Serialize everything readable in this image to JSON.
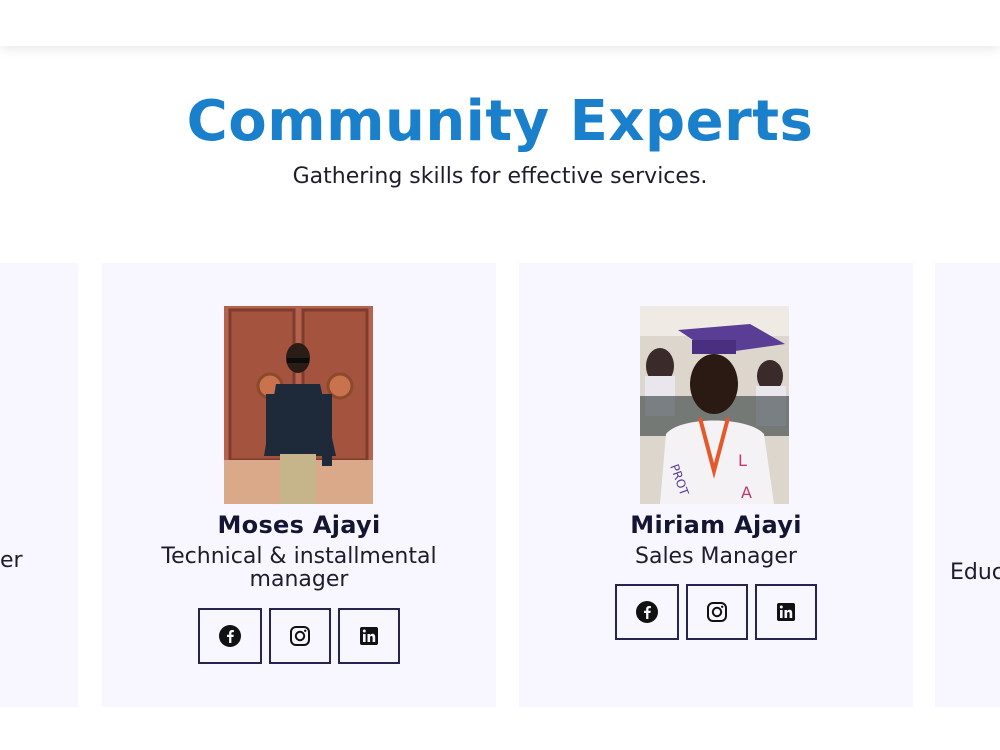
{
  "section": {
    "title": "Community Experts",
    "subtitle": "Gathering skills for effective services."
  },
  "partials": {
    "left_fragment": "er",
    "right_fragment": "Educ"
  },
  "experts": [
    {
      "name": "Moses Ajayi",
      "role": "Technical & installmental manager",
      "socials": [
        "facebook",
        "instagram",
        "linkedin"
      ]
    },
    {
      "name": "Miriam Ajayi",
      "role": "Sales Manager",
      "socials": [
        "facebook",
        "instagram",
        "linkedin"
      ]
    }
  ],
  "colors": {
    "title": "#1a80cc",
    "card_bg": "#f8f7ff",
    "text_dark": "#141433"
  }
}
